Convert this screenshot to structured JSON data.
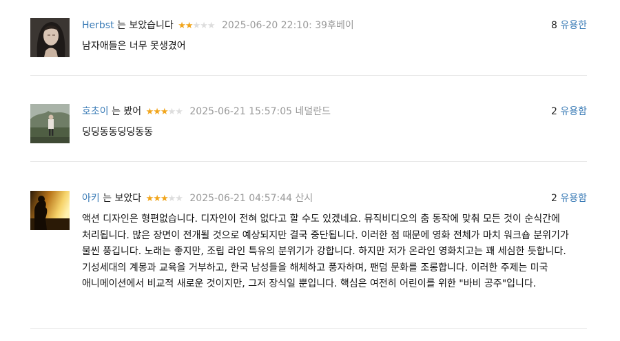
{
  "comments": [
    {
      "user": "Herbst",
      "verb": "는 보았습니다",
      "rating": 2,
      "meta": "2025-06-20 22:10: 39후베이",
      "votes_count": "8",
      "votes_label": "유용한",
      "content": "남자애들은 너무 못생겼어"
    },
    {
      "user": "호초이",
      "verb": "는 봤어",
      "rating": 3,
      "meta": "2025-06-21 15:57:05 네덜란드",
      "votes_count": "2",
      "votes_label": "유용함",
      "content": "딩딩동동딩딩동동"
    },
    {
      "user": "아키",
      "verb": "는 보았다",
      "rating": 3,
      "meta": "2025-06-21 04:57:44 산시",
      "votes_count": "2",
      "votes_label": "유용함",
      "content": "액션 디자인은 형편없습니다. 디자인이 전혀 없다고 할 수도 있겠네요. 뮤직비디오의 춤 동작에 맞춰 모든 것이 순식간에 처리됩니다. 많은 장면이 전개될 것으로 예상되지만 결국 중단됩니다. 이러한 점 때문에 영화 전체가 마치 워크숍 분위기가 물씬 풍깁니다. 노래는 좋지만, 조립 라인 특유의 분위기가 강합니다. 하지만 저가 온라인 영화치고는 꽤 세심한 듯합니다. 기성세대의 계몽과 교육을 거부하고, 한국 남성들을 해체하고 풍자하며, 팬덤 문화를 조롱합니다. 이러한 주제는 미국 애니메이션에서 비교적 새로운 것이지만, 그저 장식일 뿐입니다. 핵심은 여전히 어린이를 위한 \"바비 공주\"입니다."
    }
  ],
  "colors": {
    "username": "#3a7bb6",
    "star_on": "#f1a51c",
    "star_off": "#dddddd",
    "meta": "#999999",
    "divider": "#e8e8e8"
  },
  "icons": {
    "star": "★"
  }
}
